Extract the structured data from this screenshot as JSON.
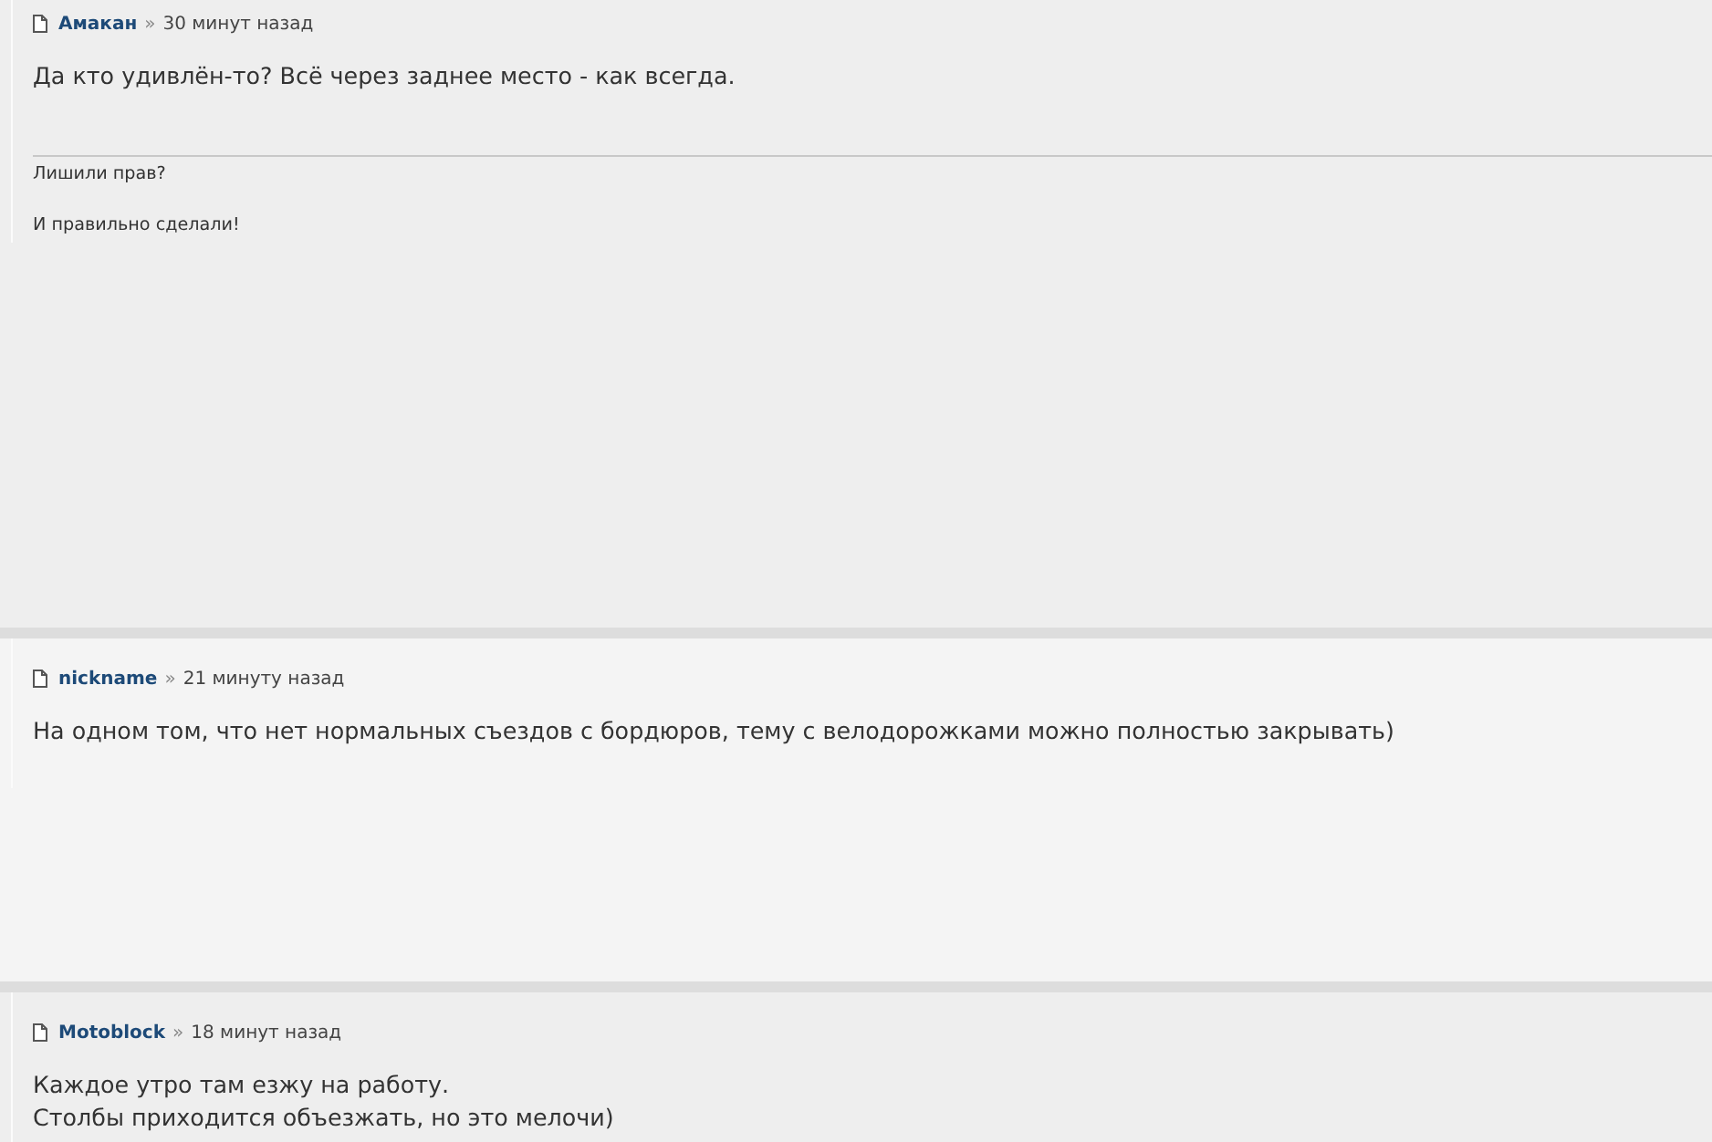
{
  "posts": [
    {
      "author": "Амакан",
      "separator": "»",
      "time": "30 минут назад",
      "body": [
        "Да кто удивлён-то? Всё через заднее место - как всегда."
      ],
      "signature": [
        "Лишили прав?",
        "И правильно сделали!"
      ]
    },
    {
      "author": "nickname",
      "separator": "»",
      "time": "21 минуту назад",
      "body": [
        "На одном том, что нет нормальных съездов с бордюров, тему с велодорожками можно полностью закрывать)"
      ]
    },
    {
      "author": "Motoblock",
      "separator": "»",
      "time": "18 минут назад",
      "body": [
        "Каждое утро там езжу на работу.",
        "Столбы приходится объезжать, но это мелочи)"
      ]
    }
  ]
}
